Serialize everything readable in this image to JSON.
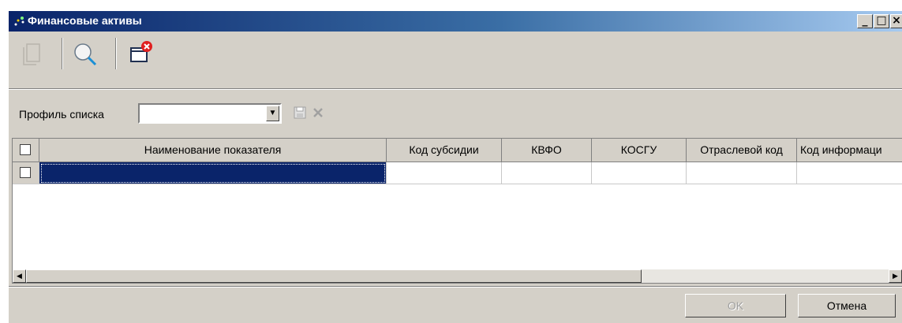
{
  "window": {
    "title": "Финансовые активы",
    "controls": {
      "minimize": "_",
      "maximize": "□",
      "close": "×"
    }
  },
  "toolbar": {
    "buttons": [
      {
        "name": "document-icon",
        "enabled": false
      },
      {
        "name": "search-icon",
        "enabled": true
      },
      {
        "name": "window-close-icon",
        "enabled": true
      }
    ]
  },
  "profile": {
    "label": "Профиль списка",
    "value": "",
    "save_icon": "save-icon",
    "delete_icon": "delete-icon"
  },
  "table": {
    "columns": [
      "Наименование показателя",
      "Код субсидии",
      "КВФО",
      "КОСГУ",
      "Отраслевой код",
      "Код информаци"
    ],
    "rows": [
      {
        "checked": false,
        "selected": true,
        "cells": [
          "",
          "",
          "",
          "",
          "",
          ""
        ]
      }
    ]
  },
  "footer": {
    "ok_label": "OK",
    "ok_enabled": false,
    "cancel_label": "Отмена"
  },
  "colors": {
    "title_bar": "#0a246a",
    "selection": "#0a246a",
    "face": "#d4d0c8"
  }
}
